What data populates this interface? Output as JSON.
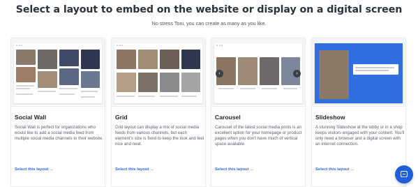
{
  "header": {
    "title": "Select a layout to embed on the website or display on a digital screen",
    "subtitle": "No stress Toni, you can create as many as you like."
  },
  "cards": [
    {
      "title": "Social Wall",
      "description": "Social Wall is perfect for organizations who would like to add a social media feed from multiple social media channels to their website.",
      "link": "Select this layout →"
    },
    {
      "title": "Grid",
      "description": "Grid layout can display a mix of social media feeds from various channels, but each element's size is fixed to keep the look and feel nice and neat.",
      "link": "Select this layout →"
    },
    {
      "title": "Carousel",
      "description": "Carousel of the latest social media posts is an excellent option for your homepage or product pages when you don't have much of vertical space available.",
      "link": "Select this layout →"
    },
    {
      "title": "Slideshow",
      "description": "A stunning Slideshow at the lobby or in a shop keeps visitors engaged with your content. You'll only need a browser and a digital screen with an internet connection.",
      "link": "Select this layout →"
    }
  ],
  "colors": {
    "accent": "#2f66d6",
    "chat_button": "#1e5fd9",
    "slideshow_bg": "#2f6fe0"
  },
  "icons": {
    "chat": "chat-icon",
    "carousel_prev": "chevron-left-icon",
    "carousel_next": "chevron-right-icon"
  }
}
